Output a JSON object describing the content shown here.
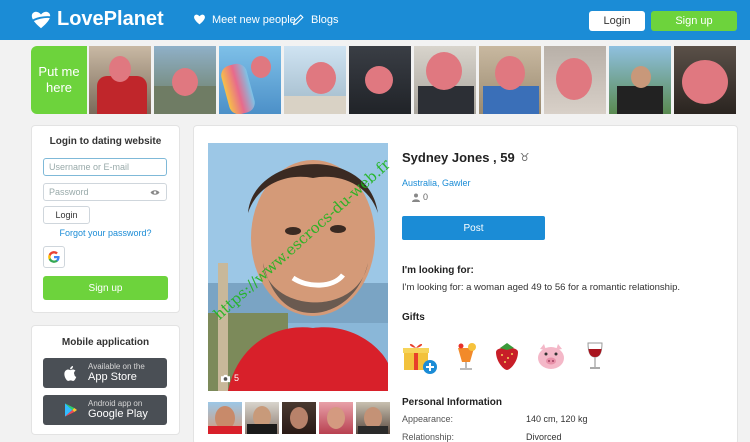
{
  "header": {
    "logo_text": "LovePlanet",
    "nav": [
      {
        "label": "Meet new people",
        "icon": "heart-icon"
      },
      {
        "label": "Blogs",
        "icon": "pencil-icon"
      }
    ],
    "login_label": "Login",
    "signup_label": "Sign up"
  },
  "strip": {
    "put_me_here": "Put me here"
  },
  "login_box": {
    "title": "Login to dating website",
    "username_placeholder": "Username or E-mail",
    "password_placeholder": "Password",
    "login_label": "Login",
    "forgot_label": "Forgot your password?",
    "signup_label": "Sign up"
  },
  "mobile_box": {
    "title": "Mobile application",
    "app_store": {
      "small": "Available on the",
      "big": "App Store"
    },
    "google_play": {
      "small": "Android app on",
      "big": "Google Play"
    }
  },
  "profile": {
    "name": "Sydney Jones , 59",
    "zodiac_symbol": "♉",
    "location": "Australia, Gawler",
    "followers": "0",
    "photo_count": "5",
    "watermark": "https://www.escrocs-du-web.fr",
    "post_label": "Post",
    "looking_title": "I'm looking for:",
    "looking_text": "I'm looking for: a woman aged 49 to 56 for a romantic relationship.",
    "gifts_title": "Gifts",
    "gifts": [
      "gift-box-icon",
      "cocktail-icon",
      "strawberry-icon",
      "pig-icon",
      "wine-glass-icon"
    ],
    "info_title": "Personal Information",
    "info": [
      {
        "label": "Appearance:",
        "value": "140 cm, 120 kg"
      },
      {
        "label": "Relationship:",
        "value": "Divorced"
      }
    ]
  },
  "colors": {
    "header_blue": "#1b8cd6",
    "accent_green": "#6dd33c",
    "watermark_green": "#1eb51e"
  }
}
